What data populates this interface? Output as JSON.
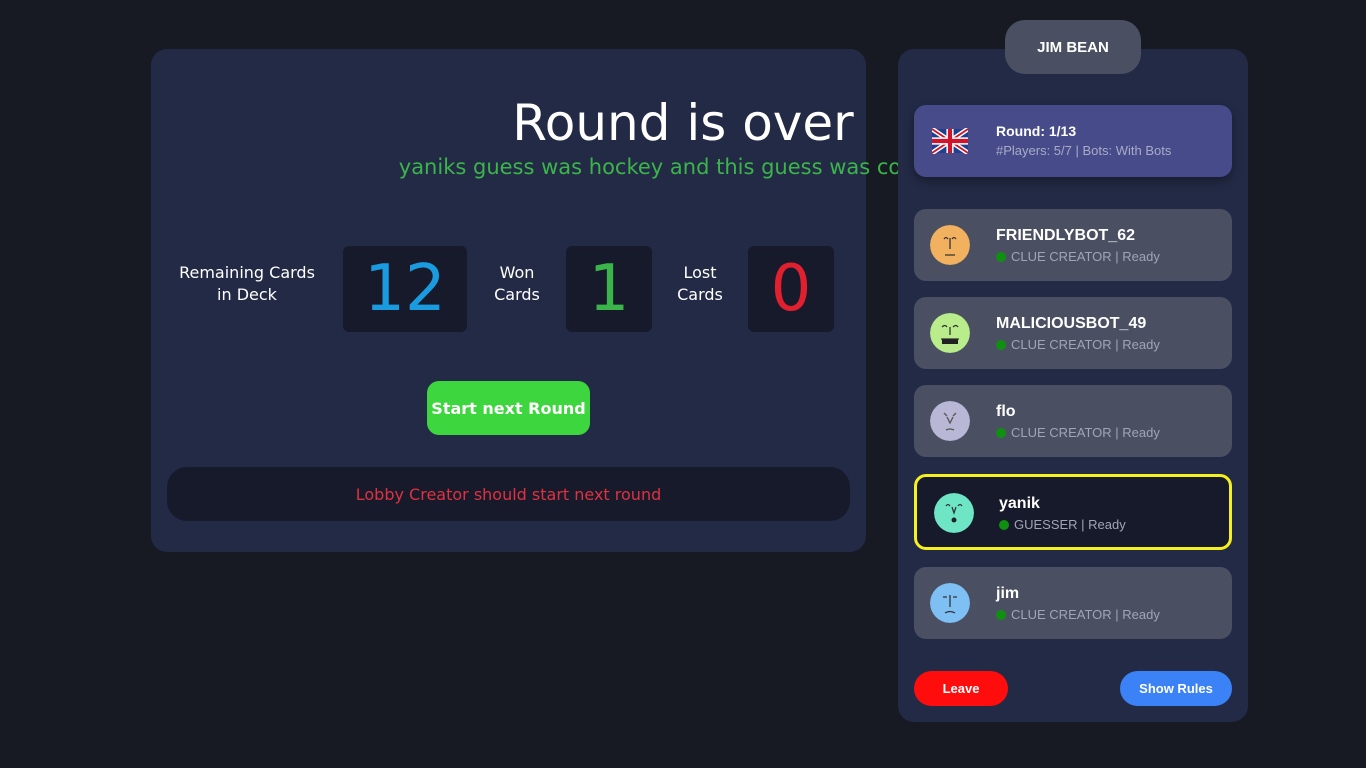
{
  "header": {
    "player_name": "JIM BEAN"
  },
  "round": {
    "title": "Round is over",
    "result": "yaniks guess was hockey and this guess was correct!!"
  },
  "stats": {
    "remaining_label": "Remaining Cards in Deck",
    "remaining_value": "12",
    "won_label": "Won Cards",
    "won_value": "1",
    "lost_label": "Lost Cards",
    "lost_value": "0"
  },
  "colors": {
    "remaining": "#1a9be0",
    "won": "#3bb54a",
    "lost": "#e0202f"
  },
  "actions": {
    "start_next": "Start next Round",
    "notice": "Lobby Creator should start next round",
    "leave": "Leave",
    "show_rules": "Show Rules"
  },
  "lobby": {
    "flag_icon": "uk-flag-icon",
    "round_label": "Round: 1/13",
    "info": "#Players: 5/7 | Bots: With Bots"
  },
  "players": [
    {
      "name": "FRIENDLYBOT_62",
      "status": "CLUE CREATOR | Ready",
      "avatar_color": "#f2b15e",
      "active": false
    },
    {
      "name": "MALICIOUSBOT_49",
      "status": "CLUE CREATOR | Ready",
      "avatar_color": "#b9ec8a",
      "active": false
    },
    {
      "name": "flo",
      "status": "CLUE CREATOR | Ready",
      "avatar_color": "#b8b8d6",
      "active": false
    },
    {
      "name": "yanik",
      "status": "GUESSER | Ready",
      "avatar_color": "#6ee6c6",
      "active": true
    },
    {
      "name": "jim",
      "status": "CLUE CREATOR | Ready",
      "avatar_color": "#7ec0f4",
      "active": false
    }
  ]
}
